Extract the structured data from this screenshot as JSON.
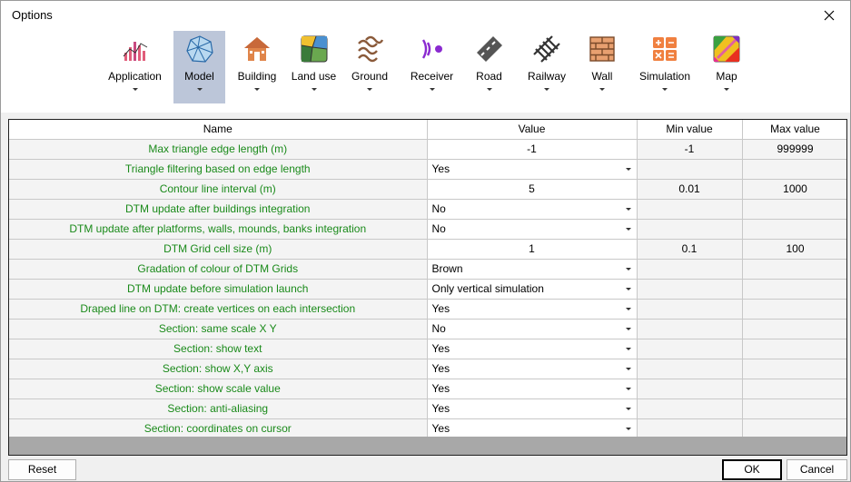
{
  "window": {
    "title": "Options"
  },
  "toolbar": {
    "items": [
      {
        "label": "Application",
        "icon": "bar-chart-icon",
        "active": false
      },
      {
        "label": "Model",
        "icon": "mesh-icon",
        "active": true
      },
      {
        "label": "Building",
        "icon": "house-icon",
        "active": false
      },
      {
        "label": "Land use",
        "icon": "land-use-map-icon",
        "active": false
      },
      {
        "label": "Ground",
        "icon": "ground-waves-icon",
        "active": false
      },
      {
        "label": "Receiver",
        "icon": "receiver-icon",
        "active": false
      },
      {
        "label": "Road",
        "icon": "road-icon",
        "active": false
      },
      {
        "label": "Railway",
        "icon": "railway-icon",
        "active": false
      },
      {
        "label": "Wall",
        "icon": "brick-wall-icon",
        "active": false
      },
      {
        "label": "Simulation",
        "icon": "calculator-icon",
        "active": false
      },
      {
        "label": "Map",
        "icon": "color-map-icon",
        "active": false
      }
    ]
  },
  "grid": {
    "headers": [
      "Name",
      "Value",
      "Min value",
      "Max value"
    ],
    "rows": [
      {
        "name": "Max triangle edge length (m)",
        "value": "-1",
        "type": "number",
        "min": "-1",
        "max": "999999"
      },
      {
        "name": "Triangle filtering based on edge length",
        "value": "Yes",
        "type": "select",
        "min": "",
        "max": ""
      },
      {
        "name": "Contour line interval (m)",
        "value": "5",
        "type": "number",
        "min": "0.01",
        "max": "1000"
      },
      {
        "name": "DTM update after buildings integration",
        "value": "No",
        "type": "select",
        "min": "",
        "max": ""
      },
      {
        "name": "DTM update after platforms, walls, mounds, banks integration",
        "value": "No",
        "type": "select",
        "min": "",
        "max": ""
      },
      {
        "name": "DTM Grid cell size (m)",
        "value": "1",
        "type": "number",
        "min": "0.1",
        "max": "100"
      },
      {
        "name": "Gradation of colour of DTM Grids",
        "value": "Brown",
        "type": "select",
        "min": "",
        "max": ""
      },
      {
        "name": "DTM update before simulation launch",
        "value": "Only vertical simulation",
        "type": "select",
        "min": "",
        "max": ""
      },
      {
        "name": "Draped line on DTM: create vertices on each intersection",
        "value": "Yes",
        "type": "select",
        "min": "",
        "max": ""
      },
      {
        "name": "Section: same scale X Y",
        "value": "No",
        "type": "select",
        "min": "",
        "max": ""
      },
      {
        "name": "Section: show text",
        "value": "Yes",
        "type": "select",
        "min": "",
        "max": ""
      },
      {
        "name": "Section: show X,Y axis",
        "value": "Yes",
        "type": "select",
        "min": "",
        "max": ""
      },
      {
        "name": "Section: show scale value",
        "value": "Yes",
        "type": "select",
        "min": "",
        "max": ""
      },
      {
        "name": "Section: anti-aliasing",
        "value": "Yes",
        "type": "select",
        "min": "",
        "max": ""
      },
      {
        "name": "Section: coordinates on cursor",
        "value": "Yes",
        "type": "select",
        "min": "",
        "max": ""
      }
    ]
  },
  "buttons": {
    "reset": "Reset",
    "ok": "OK",
    "cancel": "Cancel"
  },
  "colors": {
    "name_text": "#1a8a1a",
    "active_tab": "#bcc6d9"
  }
}
